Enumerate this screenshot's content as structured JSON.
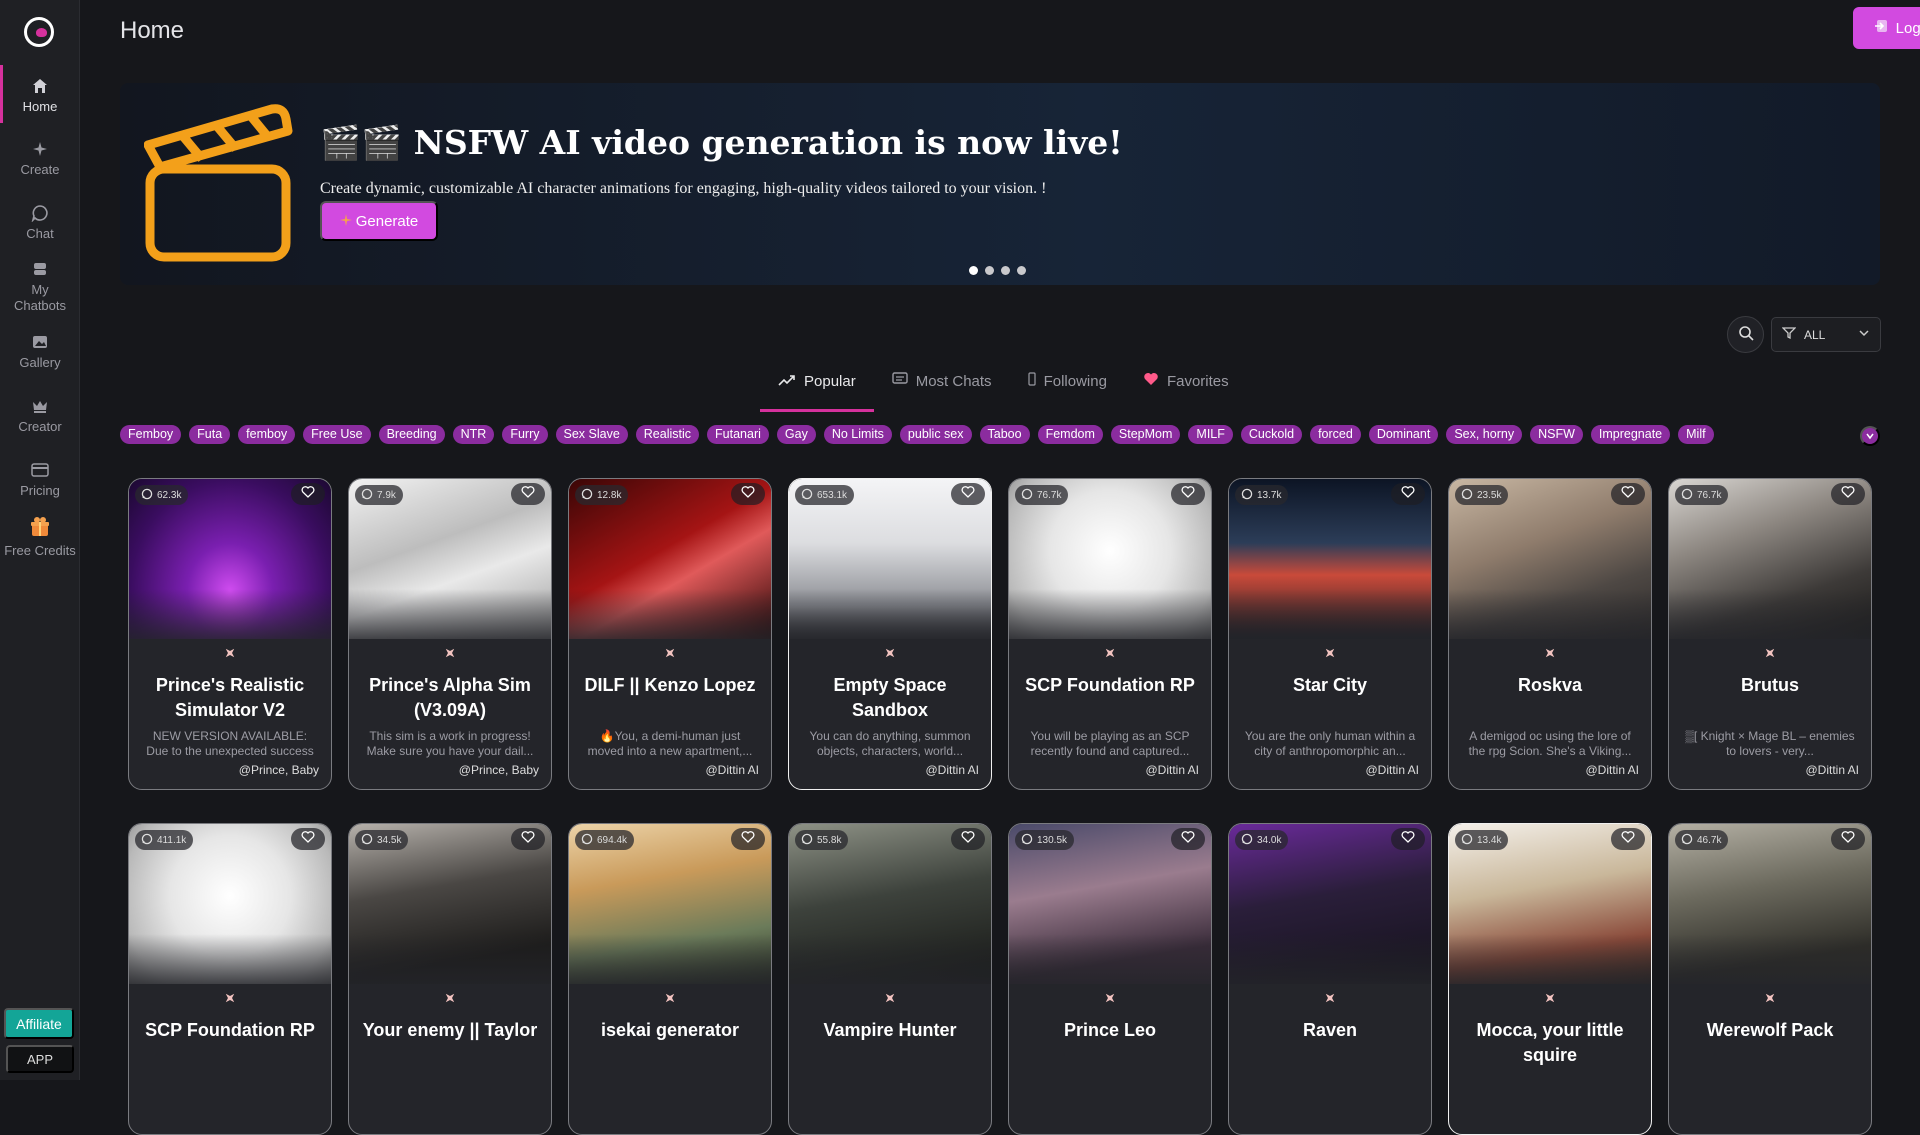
{
  "sidebar": {
    "items": [
      {
        "label": "Home",
        "icon": "home-icon"
      },
      {
        "label": "Create",
        "icon": "sparkle-icon"
      },
      {
        "label": "Chat",
        "icon": "chat-icon"
      },
      {
        "label": "My Chatbots",
        "icon": "chatbot-icon"
      },
      {
        "label": "Gallery",
        "icon": "image-icon"
      },
      {
        "label": "Creator",
        "icon": "crown-icon"
      },
      {
        "label": "Pricing",
        "icon": "card-icon"
      },
      {
        "label": "Free Credits",
        "icon": "gift-icon"
      }
    ],
    "affiliate_label": "Affiliate",
    "app_label": "APP"
  },
  "header": {
    "title": "Home",
    "login_label": "Login"
  },
  "banner": {
    "title": "🎬🎬 NSFW AI video generation is now live!",
    "subtitle": "Create dynamic, customizable AI character animations for engaging, high-quality videos tailored to your vision. !",
    "button_label": "Generate",
    "slides": 4,
    "active_slide": 1
  },
  "filter": {
    "value": "ALL"
  },
  "tabs": [
    {
      "label": "Popular",
      "icon": "trending-icon"
    },
    {
      "label": "Most Chats",
      "icon": "message-square-icon"
    },
    {
      "label": "Following",
      "icon": "user-icon"
    },
    {
      "label": "Favorites",
      "icon": "heart-icon"
    }
  ],
  "tags": [
    "Femboy",
    "Futa",
    "femboy",
    "Free Use",
    "Breeding",
    "NTR",
    "Furry",
    "Sex Slave",
    "Realistic",
    "Futanari",
    "Gay",
    "No Limits",
    "public sex",
    "Taboo",
    "Femdom",
    "StepMom",
    "MILF",
    "Cuckold",
    "forced",
    "Dominant",
    "Sex, horny",
    "NSFW",
    "Impregnate",
    "Milf"
  ],
  "colors": {
    "accent": "#d24ae0",
    "tag": "#8b2c9f",
    "brand_pink": "#d6319d"
  },
  "cards": [
    {
      "count": "62.3k",
      "name": "Prince's Realistic Simulator V2",
      "desc": "NEW VERSION AVAILABLE: Due to the unexpected success of...",
      "author": "@Prince, Baby"
    },
    {
      "count": "7.9k",
      "name": "Prince's Alpha Sim (V3.09A)",
      "desc": "This sim is a work in progress! Make sure you have your dail...",
      "author": "@Prince, Baby"
    },
    {
      "count": "12.8k",
      "name": "DILF || Kenzo Lopez",
      "desc": "🔥You, a demi-human just moved into a new apartment,...",
      "author": "@Dittin AI"
    },
    {
      "count": "653.1k",
      "name": "Empty Space Sandbox",
      "desc": "You can do anything, summon objects, characters, world...",
      "author": "@Dittin AI"
    },
    {
      "count": "76.7k",
      "name": "SCP Foundation RP",
      "desc": "You will be playing as an SCP recently found and captured...",
      "author": "@Dittin AI"
    },
    {
      "count": "13.7k",
      "name": "Star City",
      "desc": "You are the only human within a city of anthropomorphic an...",
      "author": "@Dittin AI"
    },
    {
      "count": "23.5k",
      "name": "Roskva",
      "desc": "A demigod oc using the lore of the rpg Scion. She's a Viking...",
      "author": "@Dittin AI"
    },
    {
      "count": "76.7k",
      "name": "Brutus",
      "desc": "▒[ Knight × Mage BL – enemies to lovers - very...",
      "author": "@Dittin AI"
    },
    {
      "count": "411.1k",
      "name": "SCP Foundation RP",
      "desc": "",
      "author": ""
    },
    {
      "count": "34.5k",
      "name": "Your enemy || Taylor",
      "desc": "",
      "author": ""
    },
    {
      "count": "694.4k",
      "name": "isekai generator",
      "desc": "",
      "author": ""
    },
    {
      "count": "55.8k",
      "name": "Vampire Hunter",
      "desc": "",
      "author": ""
    },
    {
      "count": "130.5k",
      "name": "Prince Leo",
      "desc": "",
      "author": ""
    },
    {
      "count": "34.0k",
      "name": "Raven",
      "desc": "",
      "author": ""
    },
    {
      "count": "13.4k",
      "name": "Mocca, your little squire",
      "desc": "",
      "author": ""
    },
    {
      "count": "46.7k",
      "name": "Werewolf Pack",
      "desc": "",
      "author": ""
    }
  ]
}
